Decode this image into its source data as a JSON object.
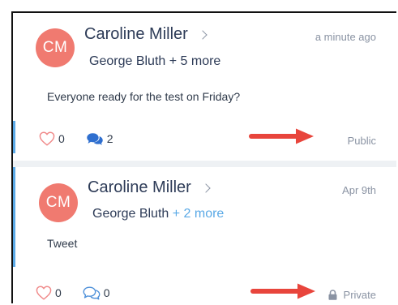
{
  "posts": [
    {
      "avatar_initials": "CM",
      "author": "Caroline Miller",
      "recipients_name": "George Bluth",
      "recipients_more": "+ 5 more",
      "timestamp": "a minute ago",
      "message": "Everyone ready for the test on Friday?",
      "like_count": "0",
      "comment_count": "2",
      "visibility": "Public",
      "visibility_icon": null
    },
    {
      "avatar_initials": "CM",
      "author": "Caroline Miller",
      "recipients_name": "George Bluth",
      "recipients_more": "+ 2 more",
      "timestamp": "Apr 9th",
      "message": "Tweet",
      "like_count": "0",
      "comment_count": "0",
      "visibility": "Private",
      "visibility_icon": "lock-icon"
    }
  ],
  "colors": {
    "avatar": "#f07a70",
    "accent": "#5aa9e6",
    "heart": "#f08a8a",
    "comment_filled": "#2f6fcf",
    "comment_outline": "#4c8fd9",
    "annotation_arrow": "#e8453c",
    "author_text": "#2d3b57",
    "muted_text": "#8a93a3",
    "divider": "#eef1f4"
  },
  "annotations": [
    "red-arrow",
    "red-arrow"
  ]
}
